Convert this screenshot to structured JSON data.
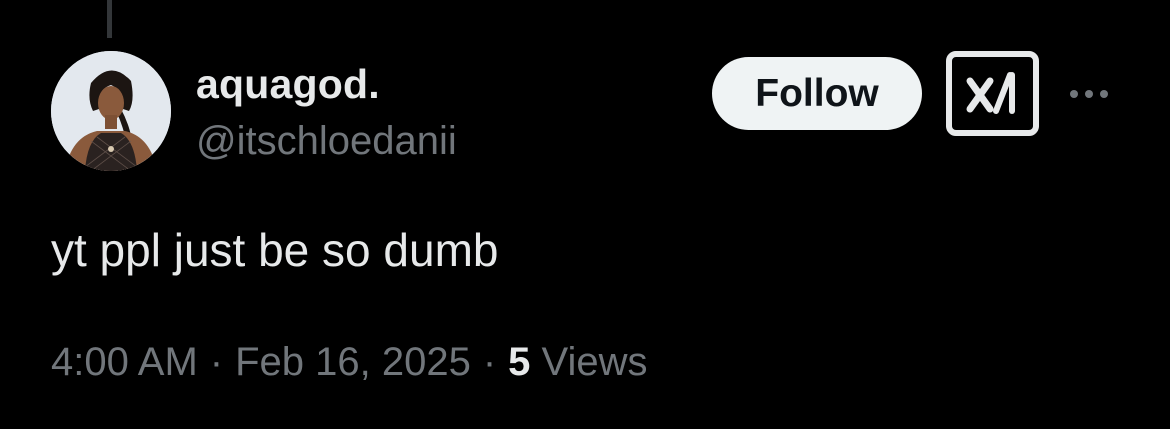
{
  "tweet": {
    "author": {
      "display_name": "aquagod.",
      "handle": "@itschloedanii",
      "avatar_icon": "profile-photo"
    },
    "text": "yt ppl just be so dumb",
    "time": "4:00 AM",
    "date": "Feb 16, 2025",
    "separator": "·",
    "views_count": "5",
    "views_label": "Views"
  },
  "actions": {
    "follow_label": "Follow",
    "grok_icon": "grok-icon",
    "more_icon": "more-options-icon"
  },
  "colors": {
    "background": "#000000",
    "primary_text": "#e7e9ea",
    "secondary_text": "#71767b",
    "follow_button_bg": "#eff3f4"
  }
}
